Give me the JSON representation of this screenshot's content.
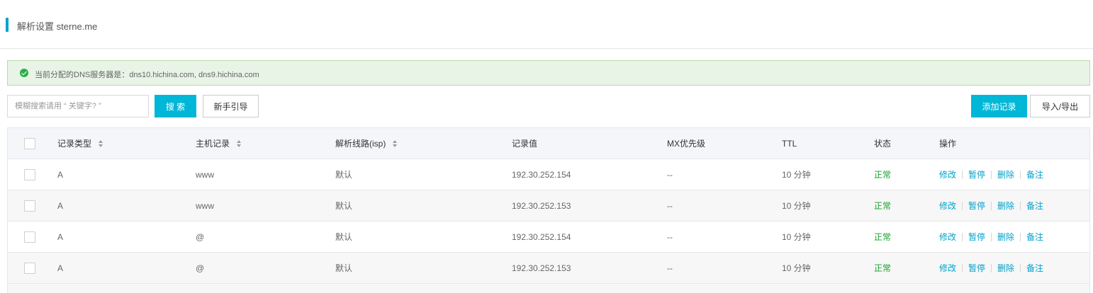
{
  "header": {
    "title": "解析设置 sterne.me"
  },
  "alert": {
    "text": "当前分配的DNS服务器是：dns10.hichina.com, dns9.hichina.com"
  },
  "toolbar": {
    "search_placeholder": "模糊搜索请用 “ 关键字? ”",
    "search_label": "搜 索",
    "guide_label": "新手引导",
    "add_label": "添加记录",
    "import_export_label": "导入/导出"
  },
  "table": {
    "columns": {
      "type": "记录类型",
      "host": "主机记录",
      "line": "解析线路(isp)",
      "value": "记录值",
      "mx": "MX优先级",
      "ttl": "TTL",
      "status": "状态",
      "ops": "操作"
    },
    "actions": {
      "edit": "修改",
      "pause": "暂停",
      "delete": "删除",
      "note": "备注"
    },
    "rows": [
      {
        "type": "A",
        "host": "www",
        "line": "默认",
        "value": "192.30.252.154",
        "mx": "--",
        "ttl": "10 分钟",
        "status": "正常"
      },
      {
        "type": "A",
        "host": "www",
        "line": "默认",
        "value": "192.30.252.153",
        "mx": "--",
        "ttl": "10 分钟",
        "status": "正常"
      },
      {
        "type": "A",
        "host": "@",
        "line": "默认",
        "value": "192.30.252.154",
        "mx": "--",
        "ttl": "10 分钟",
        "status": "正常"
      },
      {
        "type": "A",
        "host": "@",
        "line": "默认",
        "value": "192.30.252.153",
        "mx": "--",
        "ttl": "10 分钟",
        "status": "正常"
      }
    ]
  },
  "colors": {
    "accent": "#00b7d8",
    "status_ok": "#1aa12e",
    "link": "#00a2ca",
    "alert_bg": "#e8f4e6"
  }
}
